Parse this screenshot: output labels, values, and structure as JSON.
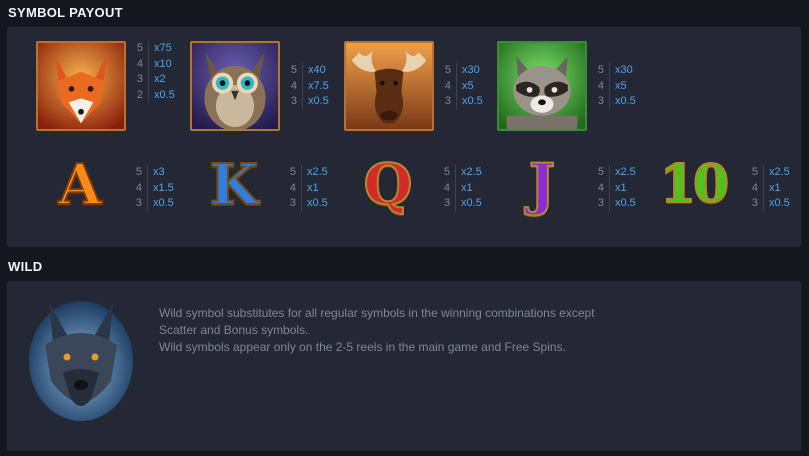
{
  "sections": {
    "symbol_payout_title": "SYMBOL PAYOUT",
    "wild_title": "WILD"
  },
  "symbols": [
    {
      "name": "fox",
      "pays": [
        {
          "count": "5",
          "mult": "x75"
        },
        {
          "count": "4",
          "mult": "x10"
        },
        {
          "count": "3",
          "mult": "x2"
        },
        {
          "count": "2",
          "mult": "x0.5"
        }
      ]
    },
    {
      "name": "owl",
      "pays": [
        {
          "count": "5",
          "mult": "x40"
        },
        {
          "count": "4",
          "mult": "x7.5"
        },
        {
          "count": "3",
          "mult": "x0.5"
        }
      ]
    },
    {
      "name": "moose",
      "pays": [
        {
          "count": "5",
          "mult": "x30"
        },
        {
          "count": "4",
          "mult": "x5"
        },
        {
          "count": "3",
          "mult": "x0.5"
        }
      ]
    },
    {
      "name": "raccoon",
      "pays": [
        {
          "count": "5",
          "mult": "x30"
        },
        {
          "count": "4",
          "mult": "x5"
        },
        {
          "count": "3",
          "mult": "x0.5"
        }
      ]
    }
  ],
  "letters": [
    {
      "glyph": "A",
      "color": "#ff8a1a",
      "pays": [
        {
          "count": "5",
          "mult": "x3"
        },
        {
          "count": "4",
          "mult": "x1.5"
        },
        {
          "count": "3",
          "mult": "x0.5"
        }
      ]
    },
    {
      "glyph": "K",
      "color": "#2f7fe0",
      "pays": [
        {
          "count": "5",
          "mult": "x2.5"
        },
        {
          "count": "4",
          "mult": "x1"
        },
        {
          "count": "3",
          "mult": "x0.5"
        }
      ]
    },
    {
      "glyph": "Q",
      "color": "#d32a2a",
      "pays": [
        {
          "count": "5",
          "mult": "x2.5"
        },
        {
          "count": "4",
          "mult": "x1"
        },
        {
          "count": "3",
          "mult": "x0.5"
        }
      ]
    },
    {
      "glyph": "J",
      "color": "#8a2bd6",
      "pays": [
        {
          "count": "5",
          "mult": "x2.5"
        },
        {
          "count": "4",
          "mult": "x1"
        },
        {
          "count": "3",
          "mult": "x0.5"
        }
      ]
    },
    {
      "glyph": "10",
      "color": "#4fc21e",
      "pays": [
        {
          "count": "5",
          "mult": "x2.5"
        },
        {
          "count": "4",
          "mult": "x1"
        },
        {
          "count": "3",
          "mult": "x0.5"
        }
      ]
    }
  ],
  "wild": {
    "icon": "wolf-icon",
    "lines": [
      "Wild symbol substitutes for all regular symbols in the winning combinations except",
      "Scatter and Bonus symbols.",
      "Wild symbols appear only on the 2-5 reels in the main game and Free Spins."
    ]
  }
}
